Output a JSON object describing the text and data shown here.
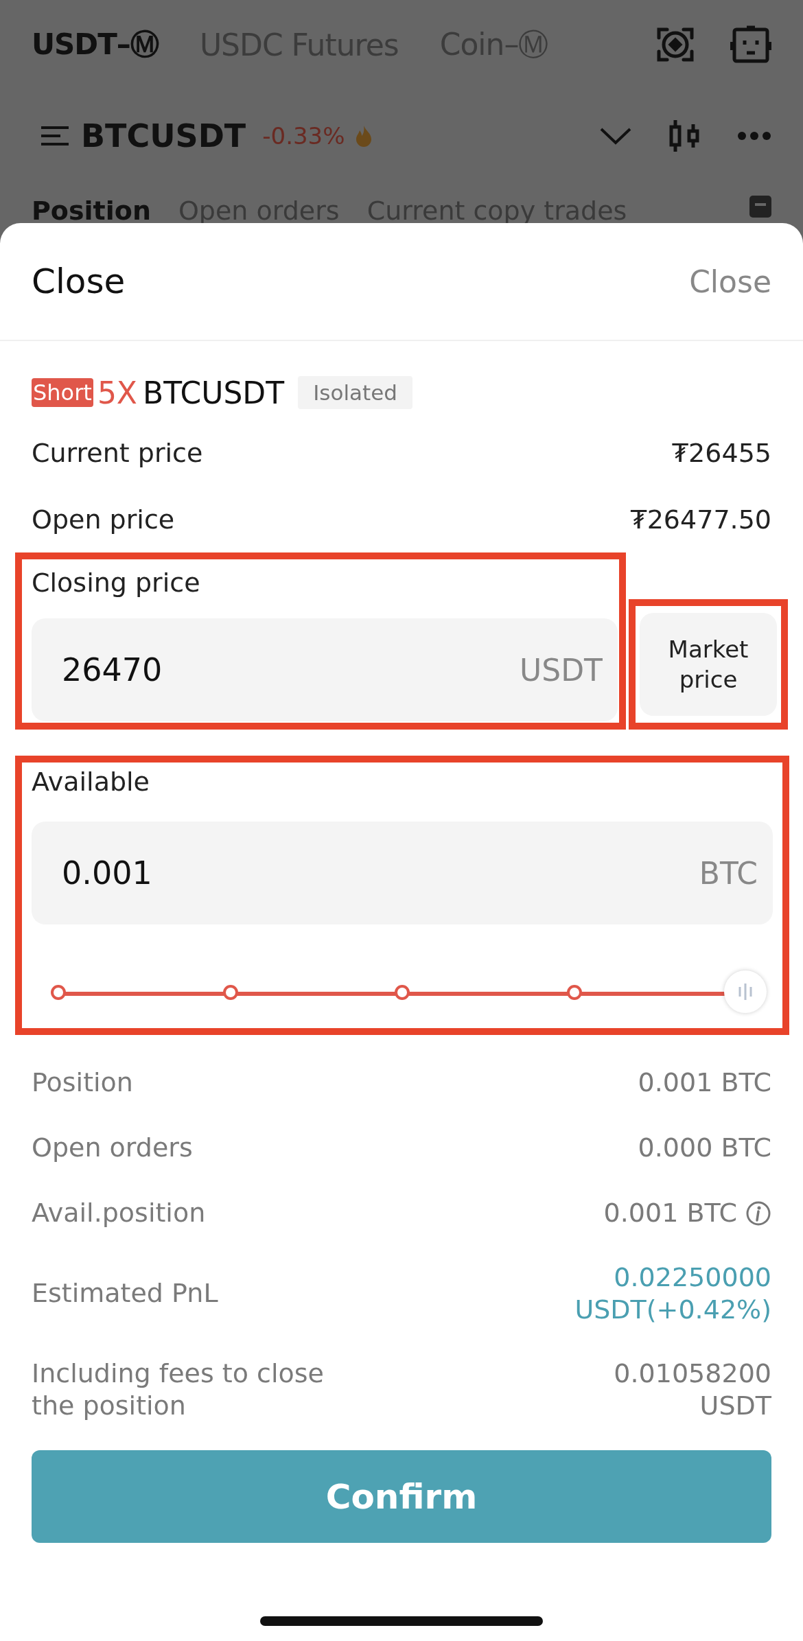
{
  "top_tabs": [
    {
      "label": "USDT–Ⓜ",
      "selected": true
    },
    {
      "label": "USDC Futures",
      "selected": false
    },
    {
      "label": "Coin–Ⓜ",
      "selected": false
    }
  ],
  "symbol": {
    "name": "BTCUSDT",
    "change": "-0.33%"
  },
  "position_tabs": [
    {
      "label": "Position",
      "selected": true
    },
    {
      "label": "Open orders",
      "selected": false
    },
    {
      "label": "Current copy trades",
      "selected": false
    }
  ],
  "sheet": {
    "title": "Close",
    "close_button": "Close",
    "position": {
      "side": "Short",
      "leverage": "5X",
      "symbol": "BTCUSDT",
      "margin_mode": "Isolated"
    },
    "prices": [
      {
        "label": "Current price",
        "value": "₮26455"
      },
      {
        "label": "Open price",
        "value": "₮26477.50"
      }
    ],
    "closing_price": {
      "label": "Closing price",
      "value": "26470",
      "unit": "USDT"
    },
    "market_button": "Market price",
    "available": {
      "label": "Available",
      "value": "0.001",
      "unit": "BTC"
    },
    "slider": {
      "level": 1
    },
    "details": [
      {
        "kind": "plain",
        "label": "Position",
        "value": "0.001 BTC"
      },
      {
        "kind": "plain",
        "label": "Open orders",
        "value": "0.000 BTC"
      },
      {
        "kind": "info",
        "label": "Avail.position",
        "value": "0.001 BTC"
      },
      {
        "kind": "profit",
        "label": "Estimated PnL",
        "value": "0.02250000 USDT(+0.42%)"
      },
      {
        "kind": "plain",
        "label": "Including fees to close the position",
        "value": "0.01058200 USDT"
      }
    ],
    "confirm_button": "Confirm"
  }
}
